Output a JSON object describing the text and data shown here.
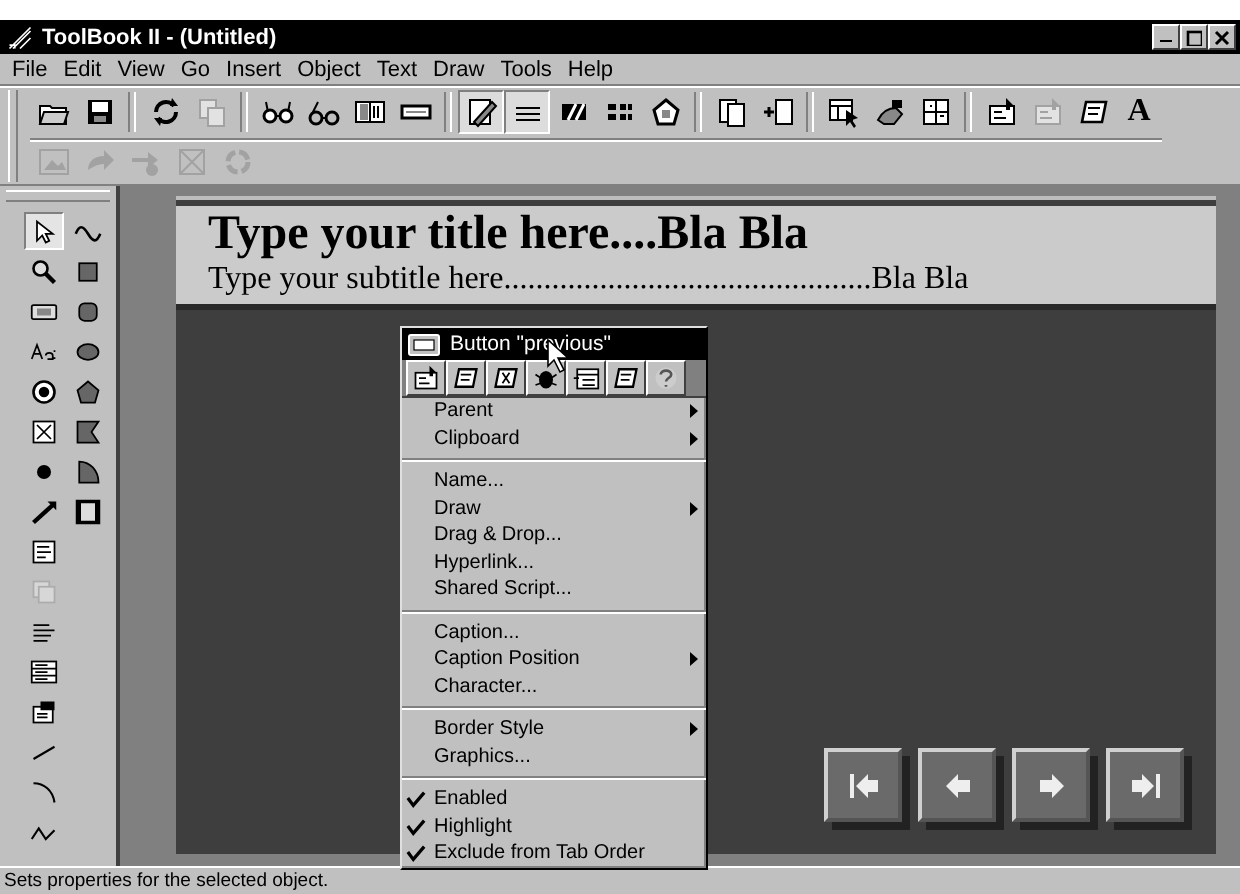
{
  "window": {
    "title": "ToolBook II - (Untitled)"
  },
  "menu_bar": [
    {
      "label": "File"
    },
    {
      "label": "Edit"
    },
    {
      "label": "View"
    },
    {
      "label": "Go"
    },
    {
      "label": "Insert"
    },
    {
      "label": "Object"
    },
    {
      "label": "Text"
    },
    {
      "label": "Draw"
    },
    {
      "label": "Tools"
    },
    {
      "label": "Help"
    }
  ],
  "toolbar": {
    "buttons": [
      {
        "disabled": false,
        "pressed": false
      },
      {
        "disabled": false,
        "pressed": false
      },
      {
        "disabled": false,
        "pressed": false
      },
      {
        "disabled": true,
        "pressed": false
      },
      {
        "disabled": false,
        "pressed": false
      },
      {
        "disabled": false,
        "pressed": false
      },
      {
        "disabled": false,
        "pressed": false
      },
      {
        "disabled": false,
        "pressed": false
      },
      {
        "disabled": false,
        "pressed": true
      },
      {
        "disabled": false,
        "pressed": true
      },
      {
        "disabled": false,
        "pressed": false
      },
      {
        "disabled": false,
        "pressed": false
      },
      {
        "disabled": false,
        "pressed": false
      },
      {
        "disabled": false,
        "pressed": false
      },
      {
        "disabled": false,
        "pressed": false
      },
      {
        "disabled": false,
        "pressed": false
      },
      {
        "disabled": false,
        "pressed": false
      },
      {
        "disabled": false,
        "pressed": false
      },
      {
        "disabled": false,
        "pressed": false
      },
      {
        "disabled": true,
        "pressed": false
      },
      {
        "disabled": false,
        "pressed": false
      }
    ],
    "text_button": "A",
    "second_row": [
      {
        "disabled": true
      },
      {
        "disabled": true
      },
      {
        "disabled": true
      },
      {
        "disabled": true
      },
      {
        "disabled": true
      }
    ]
  },
  "tool_palette": [
    {
      "selected": true,
      "disabled": false
    },
    {
      "selected": false,
      "disabled": false
    },
    {
      "selected": false,
      "disabled": false
    },
    {
      "selected": false,
      "disabled": false
    },
    {
      "selected": false,
      "disabled": false
    },
    {
      "selected": false,
      "disabled": false
    },
    {
      "selected": false,
      "disabled": false
    },
    {
      "selected": false,
      "disabled": false
    },
    {
      "selected": false,
      "disabled": false
    },
    {
      "selected": false,
      "disabled": false
    },
    {
      "selected": false,
      "disabled": false
    },
    {
      "selected": false,
      "disabled": false
    },
    {
      "selected": false,
      "disabled": false
    },
    {
      "selected": false,
      "disabled": false
    },
    {
      "selected": false,
      "disabled": false
    },
    {
      "selected": false,
      "disabled": false
    },
    {
      "selected": false,
      "disabled": false
    },
    {
      "selected": false,
      "disabled": true
    },
    {
      "selected": false,
      "disabled": false
    },
    {
      "selected": false,
      "disabled": false
    },
    {
      "selected": false,
      "disabled": false
    },
    {
      "selected": false,
      "disabled": false
    },
    {
      "selected": false,
      "disabled": false
    },
    {
      "selected": false,
      "disabled": false
    }
  ],
  "page": {
    "title": "Type your title here....Bla Bla",
    "subtitle": "Type your subtitle here..............................................Bla Bla"
  },
  "context_menu": {
    "header": "Button \"previous\"",
    "groups": [
      [
        {
          "label": "Parent",
          "submenu": true,
          "checked": false
        },
        {
          "label": "Clipboard",
          "submenu": true,
          "checked": false
        }
      ],
      [
        {
          "label": "Name...",
          "submenu": false,
          "checked": false
        },
        {
          "label": "Draw",
          "submenu": true,
          "checked": false
        },
        {
          "label": "Drag & Drop...",
          "submenu": false,
          "checked": false
        },
        {
          "label": "Hyperlink...",
          "submenu": false,
          "checked": false
        },
        {
          "label": "Shared Script...",
          "submenu": false,
          "checked": false
        }
      ],
      [
        {
          "label": "Caption...",
          "submenu": false,
          "checked": false
        },
        {
          "label": "Caption Position",
          "submenu": true,
          "checked": false
        },
        {
          "label": "Character...",
          "submenu": false,
          "checked": false
        }
      ],
      [
        {
          "label": "Border Style",
          "submenu": true,
          "checked": false
        },
        {
          "label": "Graphics...",
          "submenu": false,
          "checked": false
        }
      ],
      [
        {
          "label": "Enabled",
          "submenu": false,
          "checked": true
        },
        {
          "label": "Highlight",
          "submenu": false,
          "checked": true
        },
        {
          "label": "Exclude from Tab Order",
          "submenu": false,
          "checked": true
        }
      ]
    ]
  },
  "status_bar": {
    "text": "Sets properties for the selected object."
  }
}
